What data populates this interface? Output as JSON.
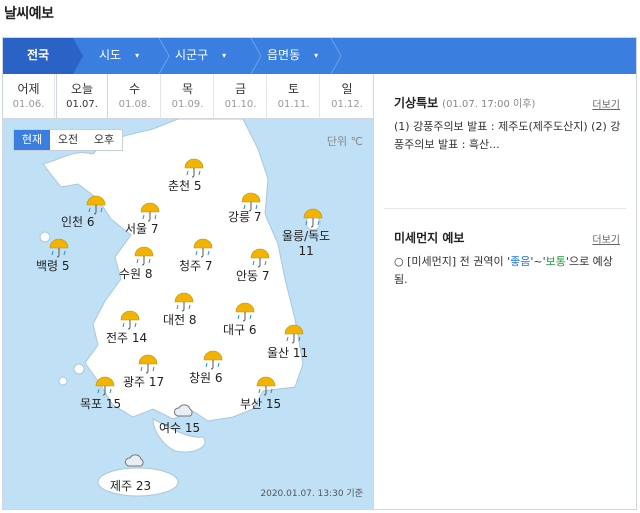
{
  "page_title": "날씨예보",
  "nav": {
    "items": [
      "전국",
      "시도",
      "시군구",
      "읍면동"
    ],
    "caret": "▾"
  },
  "days": [
    {
      "name": "어제",
      "date": "01.06."
    },
    {
      "name": "오늘",
      "date": "01.07."
    },
    {
      "name": "수",
      "date": "01.08."
    },
    {
      "name": "목",
      "date": "01.09."
    },
    {
      "name": "금",
      "date": "01.10."
    },
    {
      "name": "토",
      "date": "01.11."
    },
    {
      "name": "일",
      "date": "01.12."
    }
  ],
  "map": {
    "toggle": [
      "현재",
      "오전",
      "오후"
    ],
    "unit": "단위 ℃",
    "timestamp": "2020.01.07. 13:30 기준",
    "cities": [
      {
        "name": "춘천",
        "temp": "5",
        "icon": "umbrella-rain-icon"
      },
      {
        "name": "인천",
        "temp": "6",
        "icon": "umbrella-rain-icon"
      },
      {
        "name": "서울",
        "temp": "7",
        "icon": "umbrella-rain-icon"
      },
      {
        "name": "강릉",
        "temp": "7",
        "icon": "umbrella-rain-icon"
      },
      {
        "name": "울릉/독도",
        "temp": "11",
        "icon": "umbrella-rain-icon"
      },
      {
        "name": "백령",
        "temp": "5",
        "icon": "umbrella-rain-icon"
      },
      {
        "name": "수원",
        "temp": "8",
        "icon": "umbrella-rain-icon"
      },
      {
        "name": "청주",
        "temp": "7",
        "icon": "umbrella-rain-icon"
      },
      {
        "name": "안동",
        "temp": "7",
        "icon": "umbrella-rain-icon"
      },
      {
        "name": "대전",
        "temp": "8",
        "icon": "umbrella-rain-icon"
      },
      {
        "name": "대구",
        "temp": "6",
        "icon": "umbrella-rain-icon"
      },
      {
        "name": "전주",
        "temp": "14",
        "icon": "umbrella-rain-icon"
      },
      {
        "name": "울산",
        "temp": "11",
        "icon": "umbrella-rain-icon"
      },
      {
        "name": "광주",
        "temp": "17",
        "icon": "umbrella-rain-icon"
      },
      {
        "name": "창원",
        "temp": "6",
        "icon": "umbrella-rain-icon"
      },
      {
        "name": "목포",
        "temp": "15",
        "icon": "umbrella-rain-icon"
      },
      {
        "name": "부산",
        "temp": "15",
        "icon": "umbrella-rain-icon"
      },
      {
        "name": "여수",
        "temp": "15",
        "icon": "cloud-icon"
      },
      {
        "name": "제주",
        "temp": "23",
        "icon": "cloud-icon"
      }
    ]
  },
  "warning": {
    "title": "기상특보",
    "subtitle": "(01.07. 17:00 이후)",
    "more": "더보기",
    "body": "(1) 강풍주의보 발표 : 제주도(제주도산지) (2) 강풍주의보 발표 : 흑산..."
  },
  "dust": {
    "title": "미세먼지 예보",
    "more": "더보기",
    "prefix": "○ [미세먼지] 전 권역이 '",
    "good": "좋음",
    "mid": "'~'",
    "normal": "보통",
    "suffix": "'으로 예상됨."
  },
  "colors": {
    "nav_bg": "#3a7fe0",
    "nav_active": "#2a62c6",
    "map_bg": "#bfe0f5",
    "land": "#ffffff",
    "umbrella": "#f2b400"
  }
}
